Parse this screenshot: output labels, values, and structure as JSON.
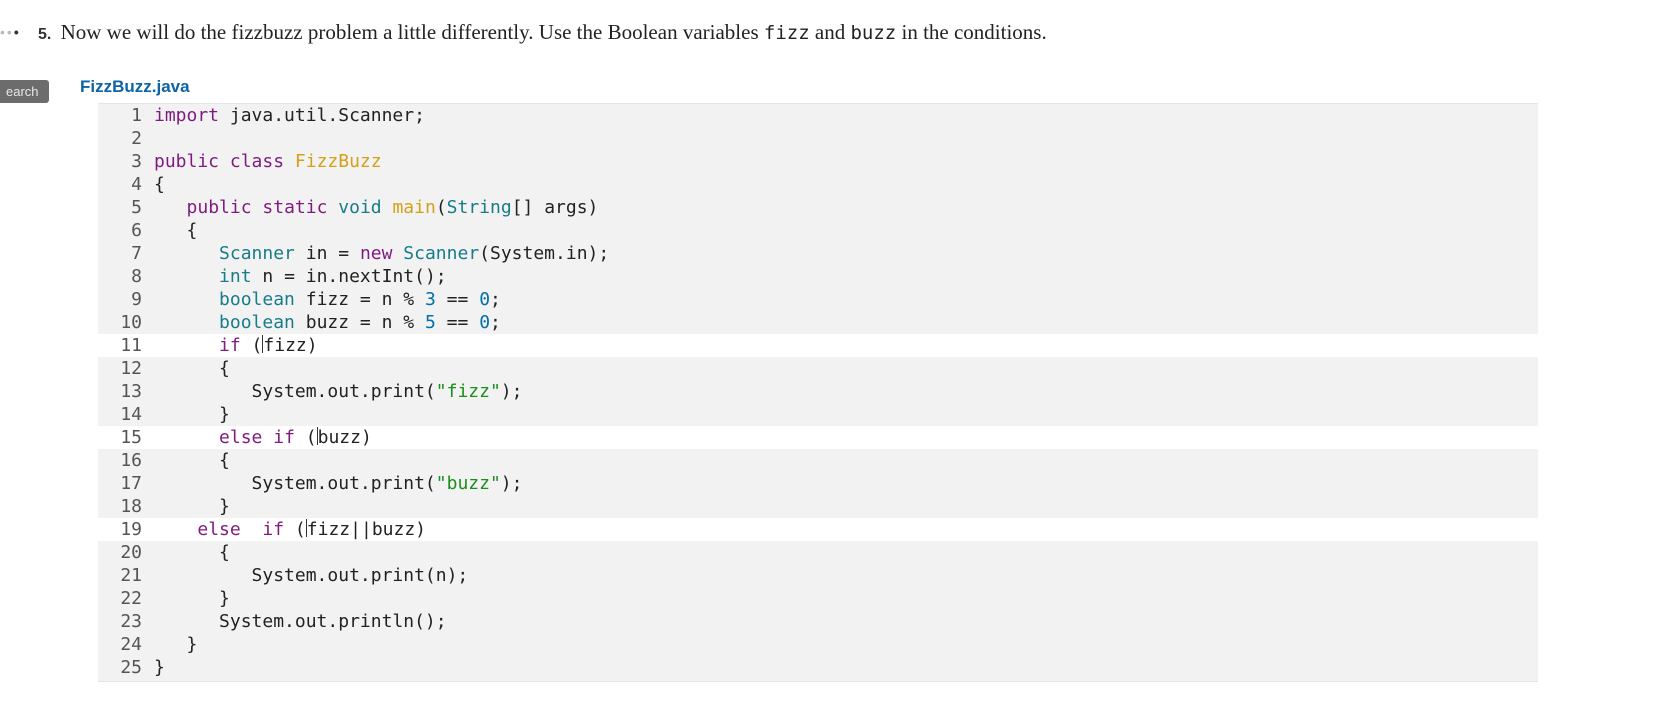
{
  "prompt": {
    "number": "5.",
    "text_before_fizz": "Now we will do the fizzbuzz problem a little differently. Use the Boolean variables ",
    "code_fizz": "fizz",
    "text_and": " and ",
    "code_buzz": "buzz",
    "text_after": " in the conditions."
  },
  "search_tab_label": "earch",
  "filename": "FizzBuzz.java",
  "code_lines": [
    {
      "n": 1,
      "active": false,
      "segments": [
        {
          "cls": "kw",
          "t": "import"
        },
        {
          "cls": "pun",
          "t": " java.util.Scanner;"
        }
      ]
    },
    {
      "n": 2,
      "active": false,
      "segments": []
    },
    {
      "n": 3,
      "active": false,
      "segments": [
        {
          "cls": "kw",
          "t": "public"
        },
        {
          "cls": "pun",
          "t": " "
        },
        {
          "cls": "kw",
          "t": "class"
        },
        {
          "cls": "pun",
          "t": " "
        },
        {
          "cls": "fn",
          "t": "FizzBuzz"
        }
      ]
    },
    {
      "n": 4,
      "active": false,
      "segments": [
        {
          "cls": "pun",
          "t": "{"
        }
      ]
    },
    {
      "n": 5,
      "active": false,
      "segments": [
        {
          "cls": "pun",
          "t": "   "
        },
        {
          "cls": "kw",
          "t": "public"
        },
        {
          "cls": "pun",
          "t": " "
        },
        {
          "cls": "kw",
          "t": "static"
        },
        {
          "cls": "pun",
          "t": " "
        },
        {
          "cls": "typ",
          "t": "void"
        },
        {
          "cls": "pun",
          "t": " "
        },
        {
          "cls": "fn",
          "t": "main"
        },
        {
          "cls": "pun",
          "t": "("
        },
        {
          "cls": "typ",
          "t": "String"
        },
        {
          "cls": "pun",
          "t": "[] args)"
        }
      ]
    },
    {
      "n": 6,
      "active": false,
      "segments": [
        {
          "cls": "pun",
          "t": "   {"
        }
      ]
    },
    {
      "n": 7,
      "active": false,
      "segments": [
        {
          "cls": "pun",
          "t": "      "
        },
        {
          "cls": "typ",
          "t": "Scanner"
        },
        {
          "cls": "pun",
          "t": " in "
        },
        {
          "cls": "op",
          "t": "="
        },
        {
          "cls": "pun",
          "t": " "
        },
        {
          "cls": "kw",
          "t": "new"
        },
        {
          "cls": "pun",
          "t": " "
        },
        {
          "cls": "typ",
          "t": "Scanner"
        },
        {
          "cls": "pun",
          "t": "(System.in);"
        }
      ]
    },
    {
      "n": 8,
      "active": false,
      "segments": [
        {
          "cls": "pun",
          "t": "      "
        },
        {
          "cls": "typ",
          "t": "int"
        },
        {
          "cls": "pun",
          "t": " n "
        },
        {
          "cls": "op",
          "t": "="
        },
        {
          "cls": "pun",
          "t": " in.nextInt();"
        }
      ]
    },
    {
      "n": 9,
      "active": false,
      "segments": [
        {
          "cls": "pun",
          "t": "      "
        },
        {
          "cls": "typ",
          "t": "boolean"
        },
        {
          "cls": "pun",
          "t": " fizz "
        },
        {
          "cls": "op",
          "t": "="
        },
        {
          "cls": "pun",
          "t": " n "
        },
        {
          "cls": "op",
          "t": "%"
        },
        {
          "cls": "pun",
          "t": " "
        },
        {
          "cls": "num",
          "t": "3"
        },
        {
          "cls": "pun",
          "t": " "
        },
        {
          "cls": "op",
          "t": "=="
        },
        {
          "cls": "pun",
          "t": " "
        },
        {
          "cls": "num",
          "t": "0"
        },
        {
          "cls": "pun",
          "t": ";"
        }
      ]
    },
    {
      "n": 10,
      "active": false,
      "segments": [
        {
          "cls": "pun",
          "t": "      "
        },
        {
          "cls": "typ",
          "t": "boolean"
        },
        {
          "cls": "pun",
          "t": " buzz "
        },
        {
          "cls": "op",
          "t": "="
        },
        {
          "cls": "pun",
          "t": " n "
        },
        {
          "cls": "op",
          "t": "%"
        },
        {
          "cls": "pun",
          "t": " "
        },
        {
          "cls": "num",
          "t": "5"
        },
        {
          "cls": "pun",
          "t": " "
        },
        {
          "cls": "op",
          "t": "=="
        },
        {
          "cls": "pun",
          "t": " "
        },
        {
          "cls": "num",
          "t": "0"
        },
        {
          "cls": "pun",
          "t": ";"
        }
      ]
    },
    {
      "n": 11,
      "active": true,
      "segments": [
        {
          "cls": "pun",
          "t": "      "
        },
        {
          "cls": "kw",
          "t": "if"
        },
        {
          "cls": "pun",
          "t": " ("
        },
        {
          "cls": "cursor",
          "t": ""
        },
        {
          "cls": "pun",
          "t": "fizz)"
        }
      ]
    },
    {
      "n": 12,
      "active": false,
      "segments": [
        {
          "cls": "pun",
          "t": "      {"
        }
      ]
    },
    {
      "n": 13,
      "active": false,
      "segments": [
        {
          "cls": "pun",
          "t": "         System.out.print("
        },
        {
          "cls": "str",
          "t": "\"fizz\""
        },
        {
          "cls": "pun",
          "t": ");"
        }
      ]
    },
    {
      "n": 14,
      "active": false,
      "segments": [
        {
          "cls": "pun",
          "t": "      }"
        }
      ]
    },
    {
      "n": 15,
      "active": true,
      "segments": [
        {
          "cls": "pun",
          "t": "      "
        },
        {
          "cls": "kw",
          "t": "else"
        },
        {
          "cls": "pun",
          "t": " "
        },
        {
          "cls": "kw",
          "t": "if"
        },
        {
          "cls": "pun",
          "t": " ("
        },
        {
          "cls": "cursor",
          "t": ""
        },
        {
          "cls": "pun",
          "t": "buzz)"
        }
      ]
    },
    {
      "n": 16,
      "active": false,
      "segments": [
        {
          "cls": "pun",
          "t": "      {"
        }
      ]
    },
    {
      "n": 17,
      "active": false,
      "segments": [
        {
          "cls": "pun",
          "t": "         System.out.print("
        },
        {
          "cls": "str",
          "t": "\"buzz\""
        },
        {
          "cls": "pun",
          "t": ");"
        }
      ]
    },
    {
      "n": 18,
      "active": false,
      "segments": [
        {
          "cls": "pun",
          "t": "      }"
        }
      ]
    },
    {
      "n": 19,
      "active": true,
      "segments": [
        {
          "cls": "pun",
          "t": "    "
        },
        {
          "cls": "kw",
          "t": "else"
        },
        {
          "cls": "pun",
          "t": "  "
        },
        {
          "cls": "kw",
          "t": "if"
        },
        {
          "cls": "pun",
          "t": " ("
        },
        {
          "cls": "cursor",
          "t": ""
        },
        {
          "cls": "pun",
          "t": "fizz"
        },
        {
          "cls": "op",
          "t": "||"
        },
        {
          "cls": "pun",
          "t": "buzz)"
        }
      ]
    },
    {
      "n": 20,
      "active": false,
      "segments": [
        {
          "cls": "pun",
          "t": "      {"
        }
      ]
    },
    {
      "n": 21,
      "active": false,
      "segments": [
        {
          "cls": "pun",
          "t": "         System.out.print(n);"
        }
      ]
    },
    {
      "n": 22,
      "active": false,
      "segments": [
        {
          "cls": "pun",
          "t": "      }"
        }
      ]
    },
    {
      "n": 23,
      "active": false,
      "segments": [
        {
          "cls": "pun",
          "t": "      System.out.println();"
        }
      ]
    },
    {
      "n": 24,
      "active": false,
      "segments": [
        {
          "cls": "pun",
          "t": "   }"
        }
      ]
    },
    {
      "n": 25,
      "active": false,
      "segments": [
        {
          "cls": "pun",
          "t": "}"
        }
      ]
    }
  ]
}
